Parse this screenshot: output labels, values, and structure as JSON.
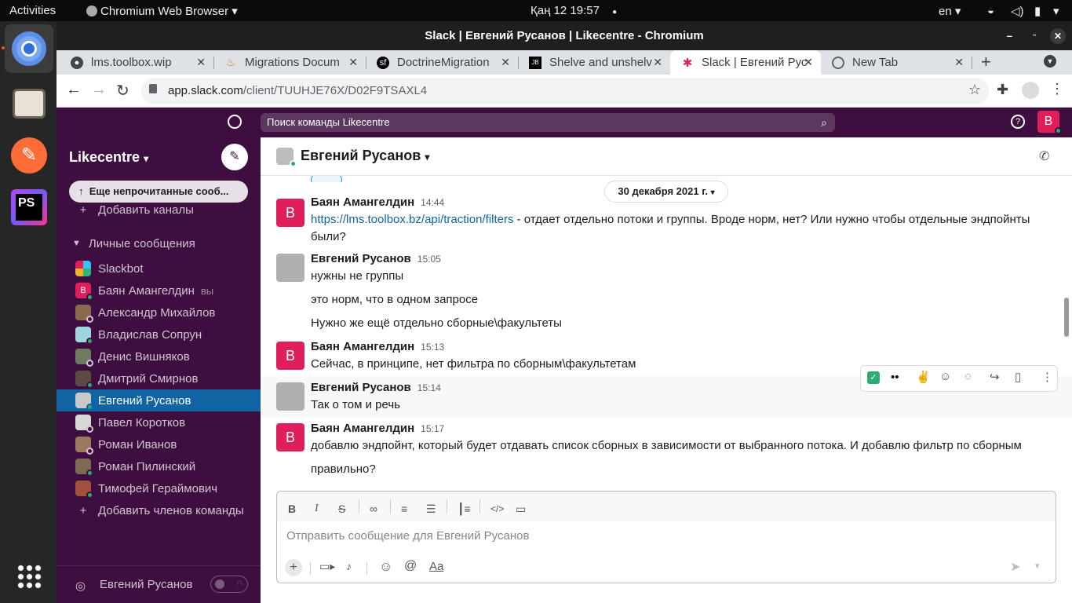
{
  "os": {
    "activities": "Activities",
    "app_name": "Chromium Web Browser",
    "clock": "Қаң 12  19:57",
    "lang": "en"
  },
  "window": {
    "title": "Slack | Евгений Русанов | Likecentre - Chromium"
  },
  "tabs": [
    {
      "label": "lms.toolbox.wip"
    },
    {
      "label": "Migrations Docum"
    },
    {
      "label": "DoctrineMigration"
    },
    {
      "label": "Shelve and unshelv"
    },
    {
      "label": "Slack | Евгений Рус"
    },
    {
      "label": "New Tab"
    }
  ],
  "address": {
    "host": "app.slack.com",
    "path": "/client/TUUHJE76X/D02F9TSAXL4"
  },
  "slack": {
    "search_placeholder": "Поиск команды Likecentre",
    "user_initial": "B",
    "workspace": "Likecentre",
    "unread_banner": "Еще непрочитанные сооб...",
    "add_channels": "Добавить каналы",
    "dm_header": "Личные сообщения",
    "dms": [
      {
        "name": "Slackbot",
        "suffix": ""
      },
      {
        "name": "Баян Амангелдин",
        "suffix": "вы"
      },
      {
        "name": "Александр Михайлов",
        "suffix": ""
      },
      {
        "name": "Владислав Сопрун",
        "suffix": ""
      },
      {
        "name": "Денис Вишняков",
        "suffix": ""
      },
      {
        "name": "Дмитрий Смирнов",
        "suffix": ""
      },
      {
        "name": "Евгений Русанов",
        "suffix": ""
      },
      {
        "name": "Павел Коротков",
        "suffix": ""
      },
      {
        "name": "Роман Иванов",
        "suffix": ""
      },
      {
        "name": "Роман Пилинский",
        "suffix": ""
      },
      {
        "name": "Тимофей Гераймович",
        "suffix": ""
      }
    ],
    "add_members": "Добавить членов команды",
    "footer_name": "Евгений Русанов",
    "channel_title": "Евгений Русанов",
    "date_divider": "30 декабря 2021 г.",
    "messages": [
      {
        "author": "Баян Амангелдин",
        "time": "14:44",
        "link": "https://lms.toolbox.bz/api/traction/filters",
        "lines": [
          " - отдает отдельно потоки и группы. Вроде норм, нет? Или нужно чтобы отдельные эндпойнты",
          "были?"
        ]
      },
      {
        "author": "Евгений Русанов",
        "time": "15:05",
        "lines": [
          "нужны не группы",
          "это норм, что в одном запросе",
          "Нужно же ещё отдельно сборные\\факультеты"
        ]
      },
      {
        "author": "Баян Амангелдин",
        "time": "15:13",
        "lines": [
          "Сейчас, в принципе, нет фильтра по сборным\\факультетам"
        ]
      },
      {
        "author": "Евгений Русанов",
        "time": "15:14",
        "lines": [
          "Так о том и речь"
        ]
      },
      {
        "author": "Баян Амангелдин",
        "time": "15:17",
        "lines": [
          "добавлю эндпойнт, который будет отдавать список сборных в зависимости от выбранного потока. И добавлю фильтр по сборным",
          "правильно?"
        ]
      }
    ],
    "composer_placeholder": "Отправить сообщение для Евгений Русанов",
    "format_aa": "Aa"
  },
  "colors": {
    "aubergine": "#3f0e40",
    "active_blue": "#1164a3",
    "link": "#1264a3",
    "bayan_pink": "#e01e5a",
    "online": "#2bac76"
  }
}
